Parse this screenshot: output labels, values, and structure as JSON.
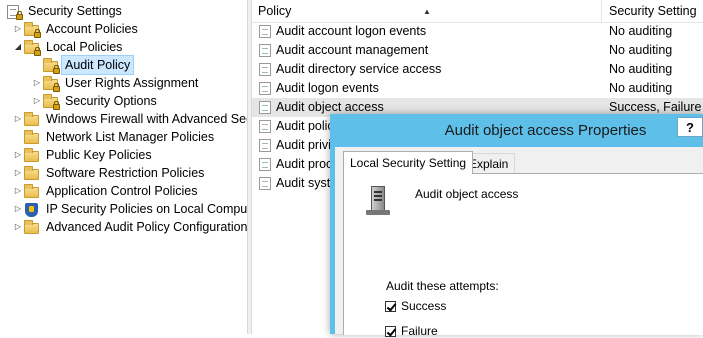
{
  "tree": {
    "items": [
      {
        "label": "Security Settings",
        "expander": "none"
      },
      {
        "label": "Account Policies",
        "expander": "collapsed"
      },
      {
        "label": "Local Policies",
        "expander": "expanded"
      },
      {
        "label": "Audit Policy",
        "expander": "none",
        "selected": true
      },
      {
        "label": "User Rights Assignment",
        "expander": "collapsed"
      },
      {
        "label": "Security Options",
        "expander": "collapsed"
      },
      {
        "label": "Windows Firewall with Advanced Secu",
        "expander": "collapsed"
      },
      {
        "label": "Network List Manager Policies",
        "expander": "none"
      },
      {
        "label": "Public Key Policies",
        "expander": "collapsed"
      },
      {
        "label": "Software Restriction Policies",
        "expander": "collapsed"
      },
      {
        "label": "Application Control Policies",
        "expander": "collapsed"
      },
      {
        "label": "IP Security Policies on Local Compute",
        "expander": "collapsed"
      },
      {
        "label": "Advanced Audit Policy Configuration",
        "expander": "collapsed"
      }
    ]
  },
  "list": {
    "columns": [
      "Policy",
      "Security Setting"
    ],
    "rows": [
      {
        "policy": "Audit account logon events",
        "setting": "No auditing"
      },
      {
        "policy": "Audit account management",
        "setting": "No auditing"
      },
      {
        "policy": "Audit directory service access",
        "setting": "No auditing"
      },
      {
        "policy": "Audit logon events",
        "setting": "No auditing"
      },
      {
        "policy": "Audit object access",
        "setting": "Success, Failure",
        "highlighted": true
      },
      {
        "policy": "Audit polic",
        "setting": ""
      },
      {
        "policy": "Audit privi",
        "setting": ""
      },
      {
        "policy": "Audit proc",
        "setting": ""
      },
      {
        "policy": "Audit syste",
        "setting": ""
      }
    ]
  },
  "dialog": {
    "title": "Audit object access Properties",
    "help": "?",
    "tabs": [
      "Local Security Setting",
      "Explain"
    ],
    "policy_name": "Audit object access",
    "attempts_label": "Audit these attempts:",
    "options": [
      {
        "label": "Success",
        "checked": true
      },
      {
        "label": "Failure",
        "checked": true
      }
    ]
  }
}
